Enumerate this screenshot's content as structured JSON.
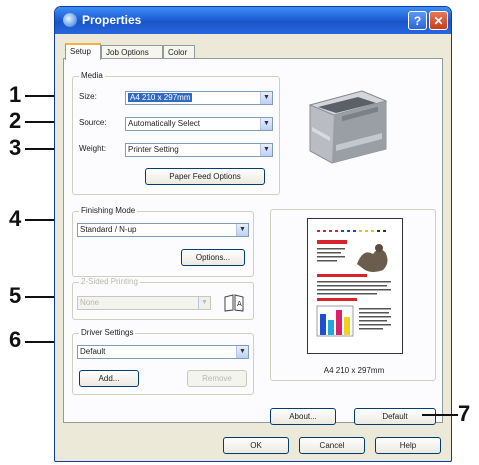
{
  "window": {
    "title": "Properties",
    "help_glyph": "?",
    "close_glyph": "✕"
  },
  "tabs": [
    {
      "label": "Setup",
      "active": true
    },
    {
      "label": "Job Options",
      "active": false
    },
    {
      "label": "Color",
      "active": false
    }
  ],
  "media": {
    "group_label": "Media",
    "size_label": "Size:",
    "size_value": "A4 210 x 297mm",
    "source_label": "Source:",
    "source_value": "Automatically Select",
    "weight_label": "Weight:",
    "weight_value": "Printer Setting",
    "paper_feed_button": "Paper Feed Options"
  },
  "finishing": {
    "group_label": "Finishing Mode",
    "value": "Standard / N-up",
    "options_button": "Options..."
  },
  "two_sided": {
    "group_label": "2-Sided Printing",
    "value": "None"
  },
  "driver_settings": {
    "group_label": "Driver Settings",
    "value": "Default",
    "add_button": "Add...",
    "remove_button": "Remove"
  },
  "preview": {
    "paper_caption": "A4 210 x 297mm"
  },
  "bottom": {
    "about_button": "About...",
    "default_button": "Default"
  },
  "dialog_buttons": {
    "ok": "OK",
    "cancel": "Cancel",
    "help": "Help"
  },
  "callouts": [
    "1",
    "2",
    "3",
    "4",
    "5",
    "6",
    "7"
  ],
  "icons": {
    "title": "properties-icon",
    "booklet": "booklet-icon",
    "printer": "printer-image"
  },
  "colors": {
    "title_bar": "#1f5fd6",
    "selection": "#316ac5",
    "dialog_bg": "#ece9d8",
    "close": "#c83c17"
  }
}
